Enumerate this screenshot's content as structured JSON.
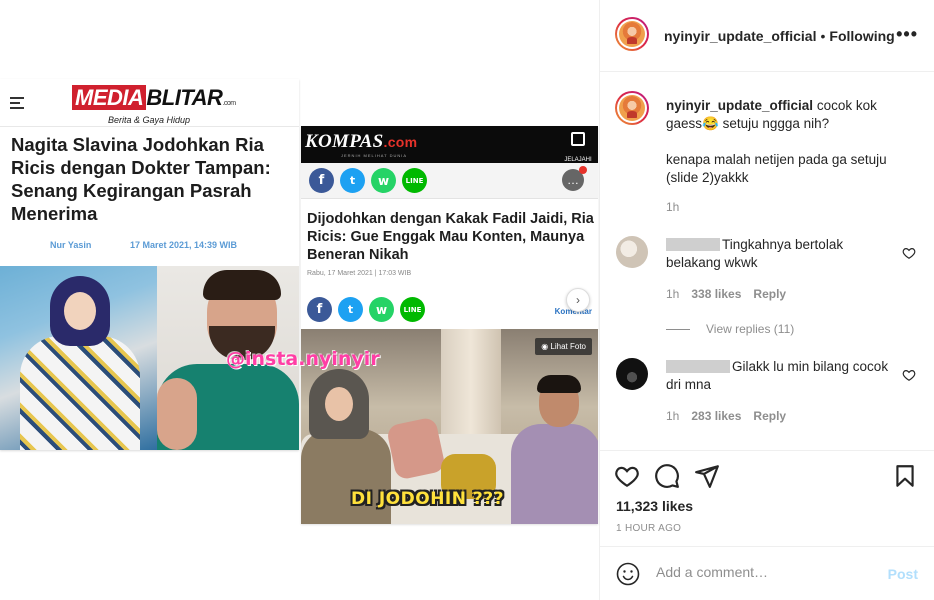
{
  "post": {
    "media": {
      "card1": {
        "logo_main": "MEDIA",
        "logo_second": "BLITAR",
        "logo_domain": ".com",
        "logo_tagline": "Berita & Gaya Hidup",
        "title": "Nagita Slavina Jodohkan Ria Ricis dengan Dokter Tampan: Senang Kegirangan Pasrah Menerima",
        "author": "Nur Yasin",
        "date": "17 Maret 2021, 14:39 WIB"
      },
      "watermark": "@insta.nyinyir",
      "card2": {
        "logo": "KOMPAS",
        "logo_suffix": ".com",
        "tagline": "JERNIH MELIHAT DUNIA",
        "explore_label": "JELAJAHI",
        "share_icons": [
          "f",
          "t",
          "w",
          "LINE"
        ],
        "title": "Dijodohkan dengan Kakak Fadil Jaidi, Ria Ricis: Gue Enggak Mau Konten, Maunya Beneran Nikah",
        "date": "Rabu, 17 Maret 2021 | 17:03 WIB",
        "comment_link": "Komentar",
        "next_arrow": "›",
        "photo_button": "Lihat Foto",
        "photo_caption": "DI JODOHIN ???"
      }
    },
    "header": {
      "username": "nyinyir_update_official",
      "separator": "•",
      "follow_status": "Following",
      "more": "•••"
    },
    "caption": {
      "username": "nyinyir_update_official",
      "line1": "cocok kok gaess😂 setuju nggga nih?",
      "line2": "kenapa malah netijen pada ga setuju (slide 2)yakkk",
      "time": "1h"
    },
    "comments": [
      {
        "text": "Tingkahnya bertolak belakang wkwk",
        "time": "1h",
        "likes": "338 likes",
        "reply": "Reply"
      },
      {
        "text": "Gilakk lu min bilang cocok dri mna",
        "time": "1h",
        "likes": "283 likes",
        "reply": "Reply"
      }
    ],
    "view_replies": "View replies (11)",
    "likes": "11,323 likes",
    "posted_ago": "1 HOUR AGO",
    "add_comment": {
      "placeholder": "Add a comment…",
      "post_label": "Post"
    }
  }
}
